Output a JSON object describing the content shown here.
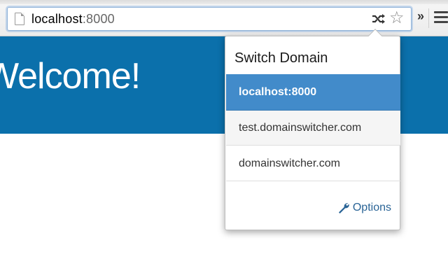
{
  "browser": {
    "url_host": "localhost",
    "url_port": ":8000",
    "icons": {
      "page": "page-icon",
      "extension": "shuffle-icon",
      "bookmark": "star-icon",
      "overflow": "chevron-double-right-icon",
      "menu": "hamburger-menu-icon"
    },
    "overflow_glyph": "»",
    "star_glyph": "☆"
  },
  "page": {
    "title": "Welcome!",
    "hero_color": "#0b70ab"
  },
  "popup": {
    "title": "Switch Domain",
    "domains": [
      {
        "label": "localhost:8000",
        "state": "selected"
      },
      {
        "label": "test.domainswitcher.com",
        "state": "hover"
      },
      {
        "label": "domainswitcher.com",
        "state": "normal"
      }
    ],
    "options_label": "Options",
    "accent_color": "#428bca",
    "link_color": "#2a6496"
  }
}
